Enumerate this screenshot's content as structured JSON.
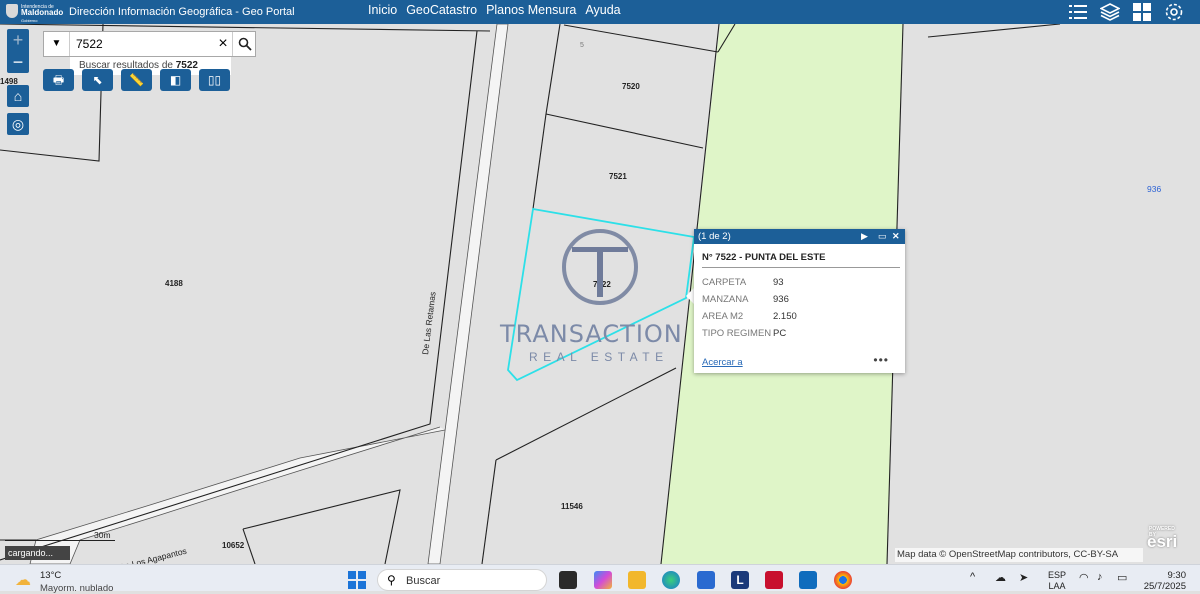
{
  "header": {
    "logo": {
      "line1": "Intendencia de",
      "line2": "Maldonado",
      "line3": "Gobierno Departamental"
    },
    "title": "Dirección Información Geográfica -  Geo Portal",
    "nav": [
      "Inicio",
      "GeoCatastro",
      "Planos Mensura",
      "Ayuda"
    ],
    "tool_icons": [
      "list-icon",
      "layers-icon",
      "basemap-gallery-icon",
      "settings-icon"
    ]
  },
  "search": {
    "value": "7522",
    "suggestion_prefix": "Buscar resultados de ",
    "suggestion_value": "7522"
  },
  "map": {
    "parcels": [
      {
        "label": "1498"
      },
      {
        "label": "5"
      },
      {
        "label": "7520"
      },
      {
        "label": "7521"
      },
      {
        "label": "4188"
      },
      {
        "label": "7522"
      },
      {
        "label": "11546"
      },
      {
        "label": "10652"
      }
    ],
    "block_label": "936",
    "streets": [
      "De Las Retamas",
      "De Los Agapantos"
    ],
    "scale_label": "30m",
    "loading_text": "cargando...",
    "attribution": "Map data © OpenStreetMap contributors, CC-BY-SA",
    "esri_powered": "POWERED BY",
    "esri_brand": "esri"
  },
  "watermark": {
    "line1": "TRANSACTION",
    "line2": "REAL ESTATE"
  },
  "popup": {
    "counter": "(1 de 2)",
    "title": "N° 7522 - PUNTA DEL ESTE",
    "fields": [
      {
        "label": "CARPETA",
        "value": "93"
      },
      {
        "label": "MANZANA",
        "value": "936"
      },
      {
        "label": "AREA M2",
        "value": "2.150"
      },
      {
        "label": "TIPO REGIMEN",
        "value": "PC"
      }
    ],
    "zoom_link": "Acercar a",
    "more": "•••"
  },
  "taskbar": {
    "weather_temp": "13°C",
    "weather_desc": "Mayorm. nublado",
    "search_placeholder": "Buscar",
    "lang_top": "ESP",
    "lang_bottom": "LAA",
    "time": "9:30",
    "date": "25/7/2025"
  },
  "colors": {
    "header_blue": "#1c5f98",
    "highlight_cyan": "#2ce0e8",
    "green_strip": "#dff5c8",
    "map_background": "#e1e1e1"
  }
}
